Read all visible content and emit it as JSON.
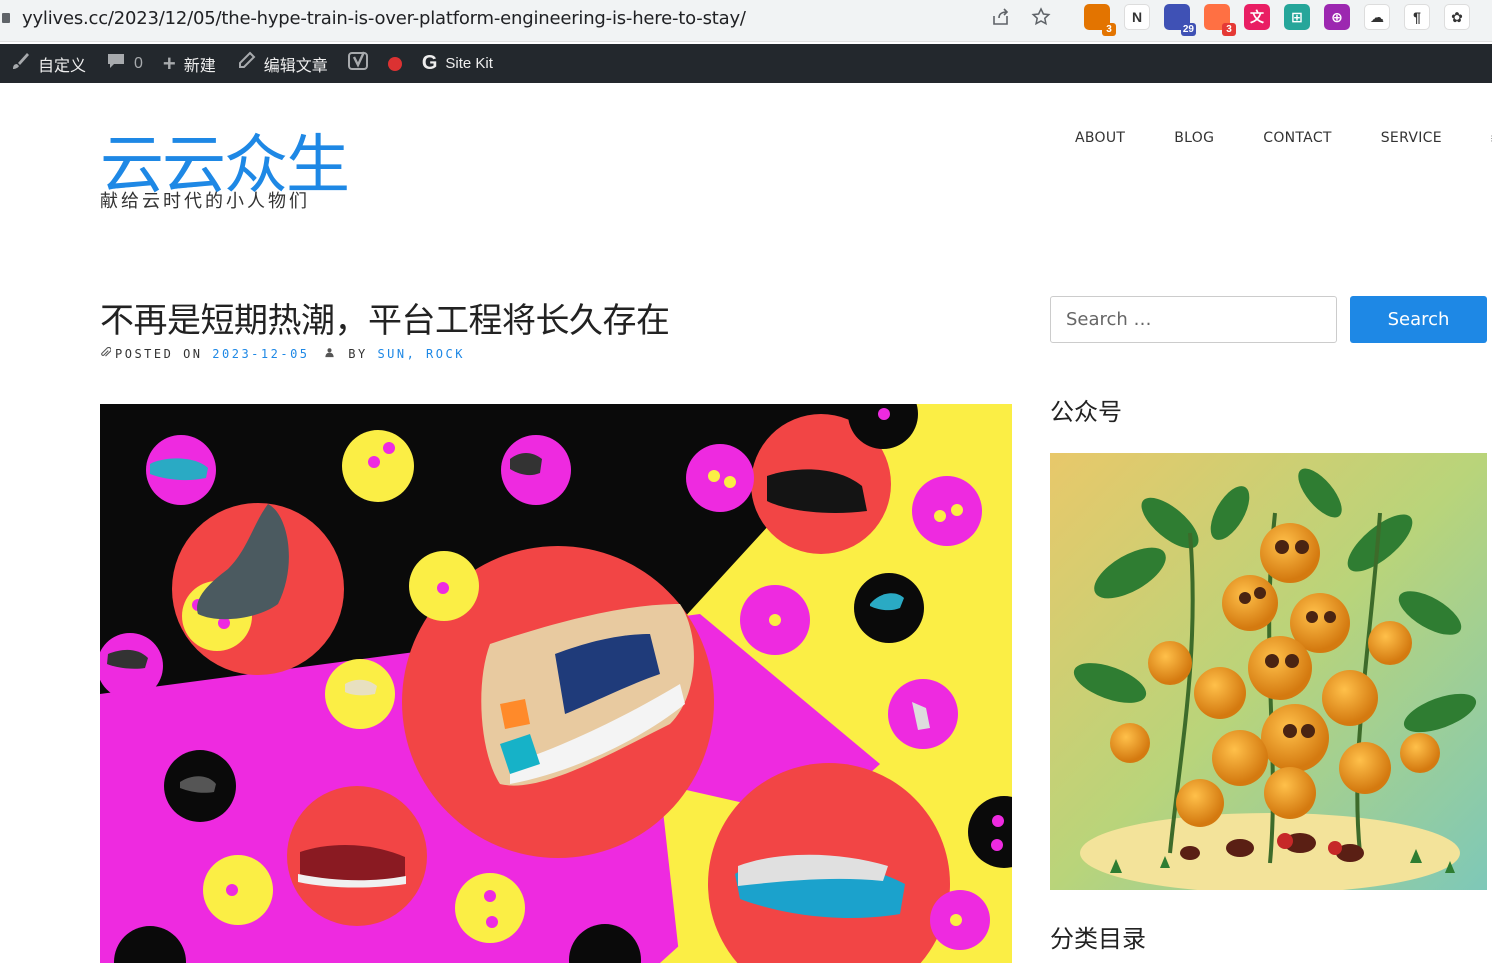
{
  "browser": {
    "url": "yylives.cc/2023/12/05/the-hype-train-is-over-platform-engineering-is-here-to-stay/",
    "extensions": [
      {
        "icon": "lighthouse-icon",
        "badge": "3",
        "bg": "#e37400",
        "badge_bg": "#e37400"
      },
      {
        "icon": "notion-icon",
        "glyph": "N",
        "bg": "#ffffff"
      },
      {
        "icon": "mortarboard-icon",
        "badge": "29",
        "bg": "#3f51b5",
        "badge_bg": "#3f51b5"
      },
      {
        "icon": "flame-icon",
        "badge": "3",
        "bg": "#ff7043",
        "badge_bg": "#e53935"
      },
      {
        "icon": "translate-icon",
        "glyph": "文",
        "bg": "#e91e63"
      },
      {
        "icon": "grid-icon",
        "glyph": "⊞",
        "bg": "#26a69a"
      },
      {
        "icon": "circle-logo-icon",
        "glyph": "⊕",
        "bg": "#9c27b0"
      },
      {
        "icon": "cloud-icon",
        "glyph": "☁",
        "bg": "#ffffff"
      },
      {
        "icon": "paragraph-icon",
        "glyph": "¶",
        "bg": "#ffffff"
      },
      {
        "icon": "openai-icon",
        "glyph": "✿",
        "bg": "#ffffff"
      }
    ]
  },
  "adminbar": {
    "customize": "自定义",
    "comments_count": "0",
    "new": "新建",
    "edit": "编辑文章",
    "sitekit": "Site Kit"
  },
  "site": {
    "title": "云云众生",
    "tagline": "献给云时代的小人物们"
  },
  "nav": [
    "ABOUT",
    "BLOG",
    "CONTACT",
    "SERVICE"
  ],
  "nav_menu_glyph": "≡",
  "post": {
    "title": "不再是短期热潮，平台工程将长久存在",
    "posted_on_label": "POSTED ON",
    "date": "2023-12-05",
    "by_label": "BY",
    "author": "SUN, ROCK"
  },
  "sidebar": {
    "search_placeholder": "Search …",
    "search_button": "Search",
    "widget_wechat": "公众号",
    "widget_categories": "分类目录"
  },
  "colors": {
    "accent": "#1e88e5",
    "adminbar_bg": "#23282d"
  }
}
